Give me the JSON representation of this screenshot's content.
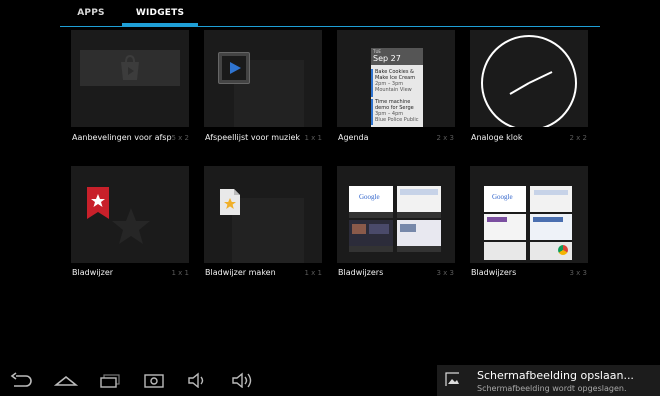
{
  "tabs": {
    "apps": "APPS",
    "widgets": "WIDGETS"
  },
  "widgets": [
    {
      "label": "Aanbevelingen voor afspe",
      "size": "5 x 2"
    },
    {
      "label": "Afspeellijst voor muziek",
      "size": "1 x 1"
    },
    {
      "label": "Agenda",
      "size": "2 x 3"
    },
    {
      "label": "Analoge klok",
      "size": "2 x 2"
    },
    {
      "label": "Bladwijzer",
      "size": "1 x 1"
    },
    {
      "label": "Bladwijzer maken",
      "size": "1 x 1"
    },
    {
      "label": "Bladwijzers",
      "size": "3 x 3"
    },
    {
      "label": "Bladwijzers",
      "size": "3 x 3"
    }
  ],
  "agenda_preview": {
    "day": "TUE",
    "date": "Sep 27",
    "events": [
      {
        "title": "Bake Cookies &",
        "title2": "Make Ice Cream",
        "time": "2pm – 3pm",
        "place": "Mountain View"
      },
      {
        "title": "Time machine",
        "title2": "demo for Serge",
        "time": "3pm – 4pm",
        "place": "Blue Police Public"
      }
    ]
  },
  "toast": {
    "title": "Schermafbeelding opslaan...",
    "subtitle": "Schermafbeelding wordt opgeslagen."
  },
  "icons": [
    "back-icon",
    "home-icon",
    "recent-apps-icon",
    "screenshot-icon",
    "volume-down-icon",
    "volume-up-icon",
    "image-icon",
    "play-icon",
    "bookmark-icon",
    "clock-icon"
  ]
}
